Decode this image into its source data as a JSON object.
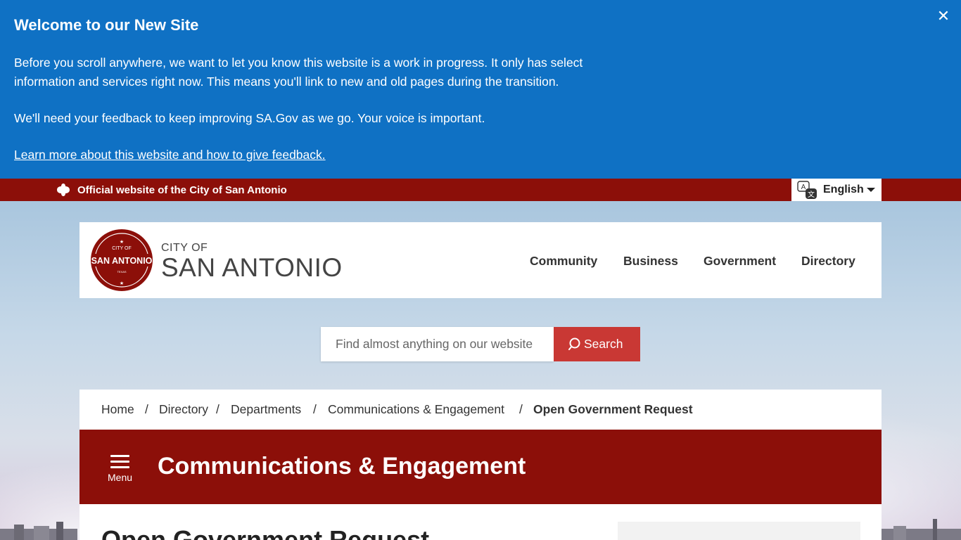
{
  "welcome": {
    "title": "Welcome to our New Site",
    "para1": "Before you scroll anywhere, we want to let you know this website is a work in progress. It only has select information and services right now. This means you'll link to new and old pages during the transition.",
    "para2": "We'll need your feedback to keep improving SA.Gov as we go. Your voice is important.",
    "link": "Learn more about this website and how to give feedback.",
    "close_label": "✕"
  },
  "official_bar": {
    "text": "Official website of the City of San Antonio",
    "icon": "seal-icon",
    "language": "English"
  },
  "header": {
    "logo_city": "CITY OF",
    "logo_name": "SAN ANTONIO",
    "logo_seal_top": "CITY OF",
    "logo_seal_main": "SAN ANTONIO",
    "logo_seal_bottom": "TEXAS",
    "nav": [
      "Community",
      "Business",
      "Government",
      "Directory"
    ]
  },
  "search": {
    "placeholder": "Find almost anything on our website",
    "button_label": "Search"
  },
  "breadcrumb": {
    "items": [
      "Home",
      "Directory",
      "Departments",
      "Communications & Engagement"
    ],
    "current": "Open Government Request"
  },
  "department": {
    "menu_label": "Menu",
    "title": "Communications & Engagement"
  },
  "content": {
    "heading": "Open Government Request"
  },
  "colors": {
    "banner_blue": "#0f71c4",
    "brand_red": "#8c0f09",
    "search_red": "#c93834"
  }
}
